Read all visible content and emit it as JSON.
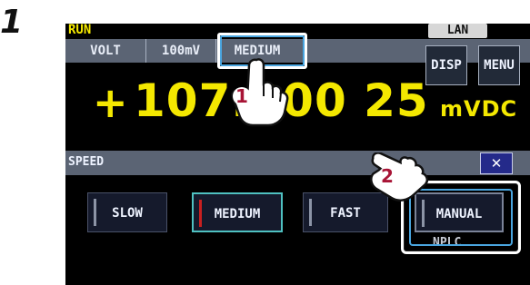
{
  "step": {
    "number": "1"
  },
  "status": {
    "run_label": "RUN",
    "lan_label": "LAN"
  },
  "top_bar": {
    "function": "VOLT",
    "range": "100mV",
    "speed": "MEDIUM"
  },
  "buttons": {
    "disp": "DISP",
    "menu": "MENU"
  },
  "reading": {
    "sign": "+",
    "value": "107.000 25",
    "unit": "mVDC"
  },
  "speed_panel": {
    "title": "SPEED",
    "close": "✕",
    "options": [
      {
        "label": "SLOW",
        "selected": false
      },
      {
        "label": "MEDIUM",
        "selected": true
      },
      {
        "label": "FAST",
        "selected": false
      },
      {
        "label": "MANUAL",
        "selected": false
      }
    ],
    "below_text": "NPLC"
  },
  "callouts": {
    "one": "1",
    "two": "2"
  },
  "colors": {
    "reading": "#f4e800",
    "bar": "#5b6474",
    "selected_border": "#4fc1c1",
    "indicator_active": "#c92020",
    "callout_highlight": "#4aa6e0",
    "close_button": "#242a8a"
  }
}
